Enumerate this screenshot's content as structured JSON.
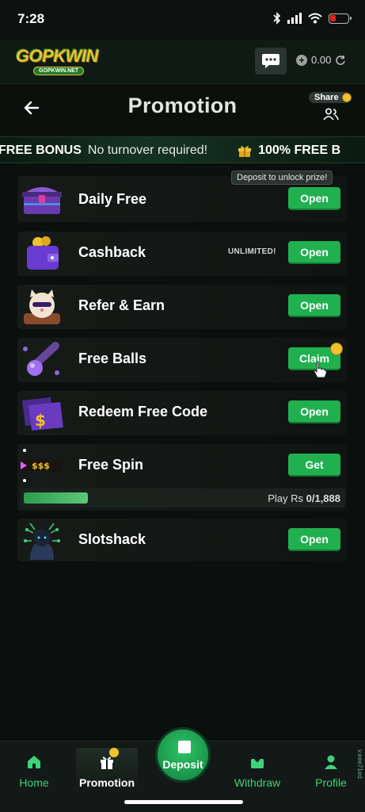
{
  "status_bar": {
    "time": "7:28"
  },
  "header": {
    "logo_text": "GOPKWIN",
    "logo_sub": "GOPKWIN.NET",
    "balance": "0.00"
  },
  "page": {
    "title": "Promotion",
    "share_label": "Share"
  },
  "marquee": {
    "segment_1_bold": "FREE BONUS",
    "segment_1_text": "No turnover required!",
    "segment_2_bold": "100% FREE B"
  },
  "promotions": [
    {
      "name": "Daily Free",
      "button": "Open",
      "tooltip": "Deposit to unlock prize!"
    },
    {
      "name": "Cashback",
      "button": "Open",
      "tag": "UNLIMITED!"
    },
    {
      "name": "Refer & Earn",
      "button": "Open"
    },
    {
      "name": "Free Balls",
      "button": "Claim"
    },
    {
      "name": "Redeem Free Code",
      "button": "Open"
    },
    {
      "name": "Free Spin",
      "button": "Get",
      "progress_label": "Play Rs",
      "progress_value": "0/1,888",
      "progress_fraction": 0.28,
      "slot_text": "$$$"
    },
    {
      "name": "Slotshack",
      "button": "Open"
    }
  ],
  "bottom_nav": {
    "items": [
      {
        "label": "Home"
      },
      {
        "label": "Promotion"
      },
      {
        "label": "Deposit"
      },
      {
        "label": "Withdraw"
      },
      {
        "label": "Profile"
      }
    ]
  },
  "side_text": "v.eee71ed",
  "colors": {
    "accent_green": "#21b04f",
    "nav_green": "#3fd27a",
    "background": "#0b0f0d",
    "gold": "#f2c12e"
  }
}
